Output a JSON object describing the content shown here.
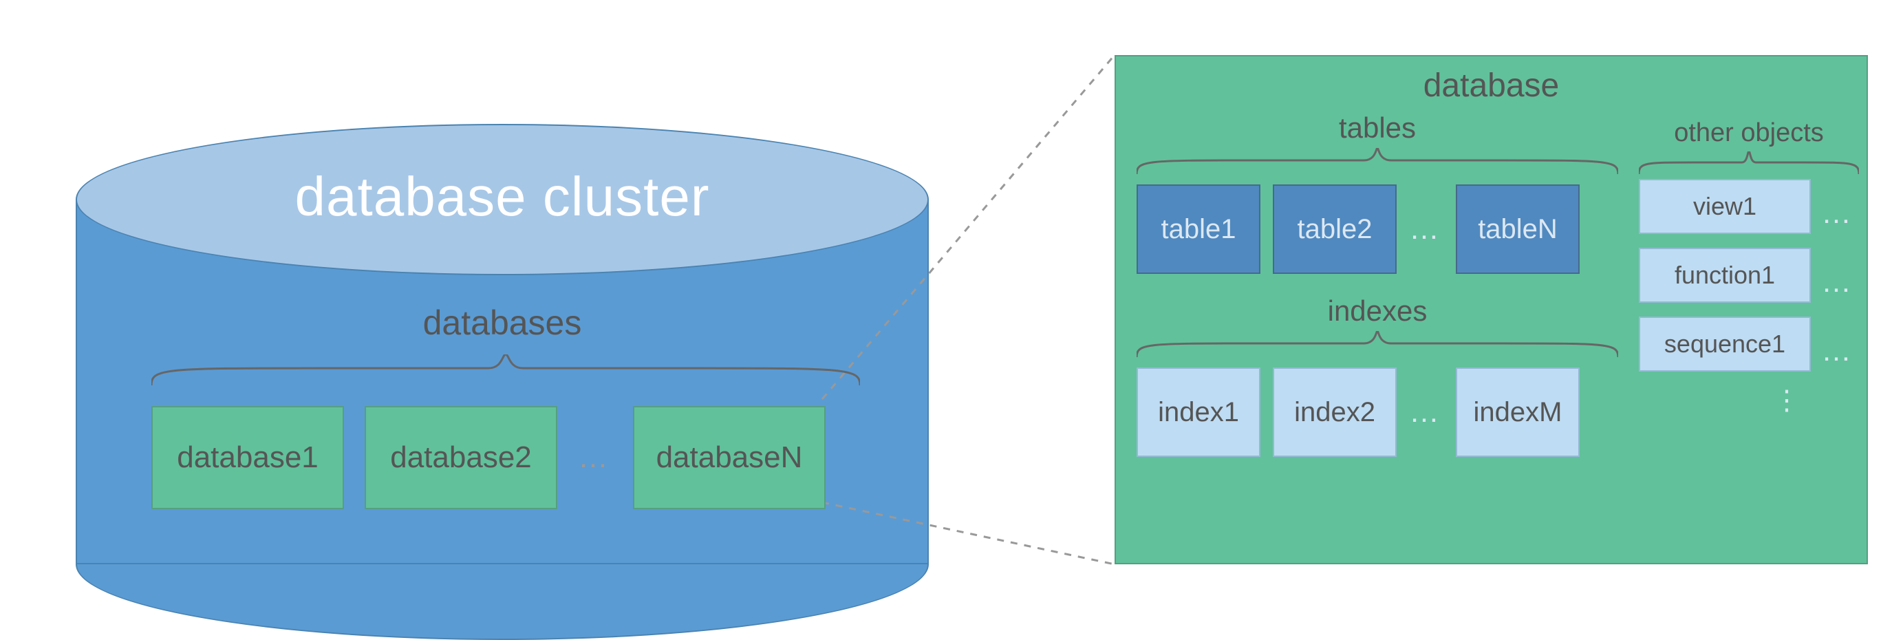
{
  "cluster": {
    "title": "database cluster",
    "subtitle": "databases",
    "items": [
      "database1",
      "database2",
      "databaseN"
    ],
    "ellipsis": "…"
  },
  "panel": {
    "title": "database",
    "tables": {
      "label": "tables",
      "items": [
        "table1",
        "table2",
        "tableN"
      ],
      "ellipsis": "…"
    },
    "indexes": {
      "label": "indexes",
      "items": [
        "index1",
        "index2",
        "indexM"
      ],
      "ellipsis": "…"
    },
    "other": {
      "label": "other objects",
      "items": [
        "view1",
        "function1",
        "sequence1"
      ],
      "ellipsis": "…",
      "vellipsis": "⋮"
    }
  }
}
